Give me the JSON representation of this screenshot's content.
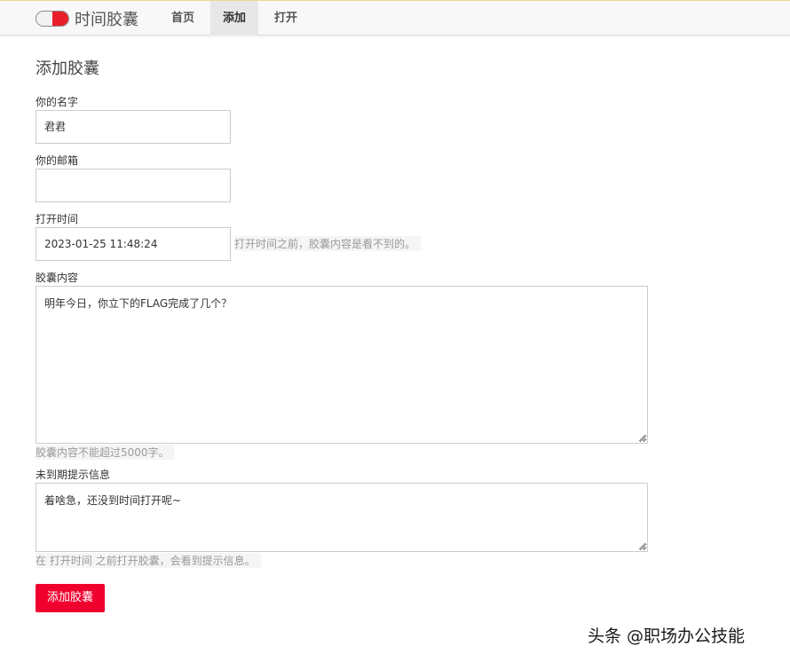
{
  "nav": {
    "brand": "时间胶囊",
    "items": [
      {
        "label": "首页",
        "active": false
      },
      {
        "label": "添加",
        "active": true
      },
      {
        "label": "打开",
        "active": false
      }
    ],
    "colors": {
      "capsule_red": "#e8202c",
      "active_bg": "#e7e7e7"
    }
  },
  "form": {
    "title": "添加胶囊",
    "name": {
      "label": "你的名字",
      "value": "君君"
    },
    "email": {
      "label": "你的邮箱",
      "value": ""
    },
    "open_time": {
      "label": "打开时间",
      "value": "2023-01-25 11:48:24",
      "hint": "打开时间之前，胶囊内容是看不到的。"
    },
    "content": {
      "label": "胶囊内容",
      "value": "明年今日，你立下的FLAG完成了几个？",
      "hint": "胶囊内容不能超过5000字。"
    },
    "premature_msg": {
      "label": "未到期提示信息",
      "value": "着啥急，还没到时间打开呢~",
      "hint": "在 打开时间 之前打开胶囊，会看到提示信息。"
    },
    "submit_label": "添加胶囊",
    "submit_color": "#f0002d"
  },
  "watermark": "头条 @职场办公技能"
}
